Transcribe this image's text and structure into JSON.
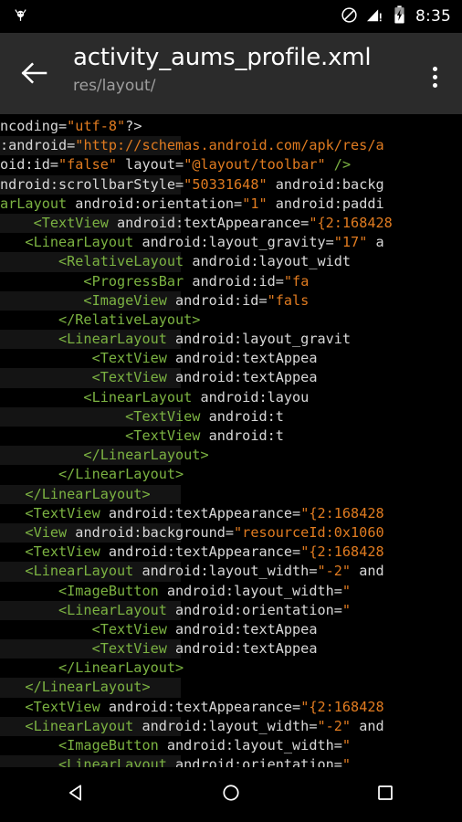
{
  "status_bar": {
    "app_icon": "android-head-icon",
    "icons": [
      "do-not-disturb-icon",
      "signal-warning-icon",
      "battery-charging-icon"
    ],
    "clock": "8:35"
  },
  "app_bar": {
    "back_icon": "arrow-back-icon",
    "title": "activity_aums_profile.xml",
    "subtitle": "res/layout/",
    "overflow_icon": "overflow-menu-icon",
    "background_color": "#2b2b2b"
  },
  "theme": {
    "editor_background": "#000000",
    "stripe_color": "#141414",
    "tag_color": "#7cb342",
    "string_color": "#e07b20",
    "text_color": "#d8d8d8",
    "title_color": "#ffffff",
    "subtitle_color": "#9e9e9e"
  },
  "editor": {
    "filename": "activity_aums_profile.xml",
    "horizontally_scrolled": true,
    "lines": [
      {
        "striped": false,
        "tokens": [
          {
            "t": "plain",
            "v": "ncoding="
          },
          {
            "t": "str",
            "v": "\"utf-8\""
          },
          {
            "t": "plain",
            "v": "?>"
          }
        ]
      },
      {
        "striped": true,
        "tokens": [
          {
            "t": "plain",
            "v": ":android="
          },
          {
            "t": "str",
            "v": "\"http://schemas.android.com/apk/res/a"
          }
        ]
      },
      {
        "striped": false,
        "tokens": [
          {
            "t": "plain",
            "v": "oid:id="
          },
          {
            "t": "str",
            "v": "\"false\""
          },
          {
            "t": "plain",
            "v": " layout="
          },
          {
            "t": "str",
            "v": "\"@layout/toolbar\""
          },
          {
            "t": "plain",
            "v": " "
          },
          {
            "t": "tag",
            "v": "/>"
          }
        ]
      },
      {
        "striped": true,
        "tokens": [
          {
            "t": "plain",
            "v": "ndroid:scrollbarStyle="
          },
          {
            "t": "str",
            "v": "\"50331648\""
          },
          {
            "t": "plain",
            "v": " android:backg"
          }
        ]
      },
      {
        "striped": false,
        "tokens": [
          {
            "t": "tag",
            "v": "arLayout"
          },
          {
            "t": "plain",
            "v": " android:orientation="
          },
          {
            "t": "str",
            "v": "\"1\""
          },
          {
            "t": "plain",
            "v": " android:paddi"
          }
        ]
      },
      {
        "striped": true,
        "tokens": [
          {
            "t": "tag",
            "v": "    <TextView"
          },
          {
            "t": "plain",
            "v": " android:textAppearance="
          },
          {
            "t": "str",
            "v": "\"{2:168428"
          }
        ]
      },
      {
        "striped": false,
        "tokens": [
          {
            "t": "tag",
            "v": "   <LinearLayout"
          },
          {
            "t": "plain",
            "v": " android:layout_gravity="
          },
          {
            "t": "str",
            "v": "\"17\""
          },
          {
            "t": "plain",
            "v": " a"
          }
        ]
      },
      {
        "striped": true,
        "tokens": [
          {
            "t": "tag",
            "v": "       <RelativeLayout"
          },
          {
            "t": "plain",
            "v": " android:layout_widt"
          }
        ]
      },
      {
        "striped": false,
        "tokens": [
          {
            "t": "tag",
            "v": "          <ProgressBar"
          },
          {
            "t": "plain",
            "v": " android:id="
          },
          {
            "t": "str",
            "v": "\"fa"
          }
        ]
      },
      {
        "striped": true,
        "tokens": [
          {
            "t": "tag",
            "v": "          <ImageView"
          },
          {
            "t": "plain",
            "v": " android:id="
          },
          {
            "t": "str",
            "v": "\"fals"
          }
        ]
      },
      {
        "striped": false,
        "tokens": [
          {
            "t": "tag",
            "v": "       </RelativeLayout>"
          }
        ]
      },
      {
        "striped": true,
        "tokens": [
          {
            "t": "tag",
            "v": "       <LinearLayout"
          },
          {
            "t": "plain",
            "v": " android:layout_gravit"
          }
        ]
      },
      {
        "striped": false,
        "tokens": [
          {
            "t": "tag",
            "v": "           <TextView"
          },
          {
            "t": "plain",
            "v": " android:textAppea"
          }
        ]
      },
      {
        "striped": true,
        "tokens": [
          {
            "t": "tag",
            "v": "           <TextView"
          },
          {
            "t": "plain",
            "v": " android:textAppea"
          }
        ]
      },
      {
        "striped": false,
        "tokens": [
          {
            "t": "tag",
            "v": "          <LinearLayout"
          },
          {
            "t": "plain",
            "v": " android:layou"
          }
        ]
      },
      {
        "striped": true,
        "tokens": [
          {
            "t": "tag",
            "v": "               <TextView"
          },
          {
            "t": "plain",
            "v": " android:t"
          }
        ]
      },
      {
        "striped": false,
        "tokens": [
          {
            "t": "tag",
            "v": "               <TextView"
          },
          {
            "t": "plain",
            "v": " android:t"
          }
        ]
      },
      {
        "striped": true,
        "tokens": [
          {
            "t": "tag",
            "v": "          </LinearLayout>"
          }
        ]
      },
      {
        "striped": false,
        "tokens": [
          {
            "t": "tag",
            "v": "       </LinearLayout>"
          }
        ]
      },
      {
        "striped": true,
        "tokens": [
          {
            "t": "tag",
            "v": "   </LinearLayout>"
          }
        ]
      },
      {
        "striped": false,
        "tokens": [
          {
            "t": "tag",
            "v": "   <TextView"
          },
          {
            "t": "plain",
            "v": " android:textAppearance="
          },
          {
            "t": "str",
            "v": "\"{2:168428"
          }
        ]
      },
      {
        "striped": true,
        "tokens": [
          {
            "t": "tag",
            "v": "   <View"
          },
          {
            "t": "plain",
            "v": " android:background="
          },
          {
            "t": "str",
            "v": "\"resourceId:0x1060"
          }
        ]
      },
      {
        "striped": false,
        "tokens": [
          {
            "t": "tag",
            "v": "   <TextView"
          },
          {
            "t": "plain",
            "v": " android:textAppearance="
          },
          {
            "t": "str",
            "v": "\"{2:168428"
          }
        ]
      },
      {
        "striped": true,
        "tokens": [
          {
            "t": "tag",
            "v": "   <LinearLayout"
          },
          {
            "t": "plain",
            "v": " android:layout_width="
          },
          {
            "t": "str",
            "v": "\"-2\""
          },
          {
            "t": "plain",
            "v": " and"
          }
        ]
      },
      {
        "striped": false,
        "tokens": [
          {
            "t": "tag",
            "v": "       <ImageButton"
          },
          {
            "t": "plain",
            "v": " android:layout_width="
          },
          {
            "t": "str",
            "v": "\""
          }
        ]
      },
      {
        "striped": true,
        "tokens": [
          {
            "t": "tag",
            "v": "       <LinearLayout"
          },
          {
            "t": "plain",
            "v": " android:orientation="
          },
          {
            "t": "str",
            "v": "\""
          }
        ]
      },
      {
        "striped": false,
        "tokens": [
          {
            "t": "tag",
            "v": "           <TextView"
          },
          {
            "t": "plain",
            "v": " android:textAppea"
          }
        ]
      },
      {
        "striped": true,
        "tokens": [
          {
            "t": "tag",
            "v": "           <TextView"
          },
          {
            "t": "plain",
            "v": " android:textAppea"
          }
        ]
      },
      {
        "striped": false,
        "tokens": [
          {
            "t": "tag",
            "v": "       </LinearLayout>"
          }
        ]
      },
      {
        "striped": true,
        "tokens": [
          {
            "t": "tag",
            "v": "   </LinearLayout>"
          }
        ]
      },
      {
        "striped": false,
        "tokens": [
          {
            "t": "tag",
            "v": "   <TextView"
          },
          {
            "t": "plain",
            "v": " android:textAppearance="
          },
          {
            "t": "str",
            "v": "\"{2:168428"
          }
        ]
      },
      {
        "striped": true,
        "tokens": [
          {
            "t": "tag",
            "v": "   <LinearLayout"
          },
          {
            "t": "plain",
            "v": " android:layout_width="
          },
          {
            "t": "str",
            "v": "\"-2\""
          },
          {
            "t": "plain",
            "v": " and"
          }
        ]
      },
      {
        "striped": false,
        "tokens": [
          {
            "t": "tag",
            "v": "       <ImageButton"
          },
          {
            "t": "plain",
            "v": " android:layout_width="
          },
          {
            "t": "str",
            "v": "\""
          }
        ]
      },
      {
        "striped": true,
        "tokens": [
          {
            "t": "tag",
            "v": "       <LinearLayout"
          },
          {
            "t": "plain",
            "v": " android:orientation="
          },
          {
            "t": "str",
            "v": "\""
          }
        ]
      }
    ]
  },
  "nav_bar": {
    "buttons": [
      {
        "name": "back-nav-button",
        "icon": "triangle-back-icon"
      },
      {
        "name": "home-nav-button",
        "icon": "circle-home-icon"
      },
      {
        "name": "recents-nav-button",
        "icon": "square-recents-icon"
      }
    ]
  }
}
